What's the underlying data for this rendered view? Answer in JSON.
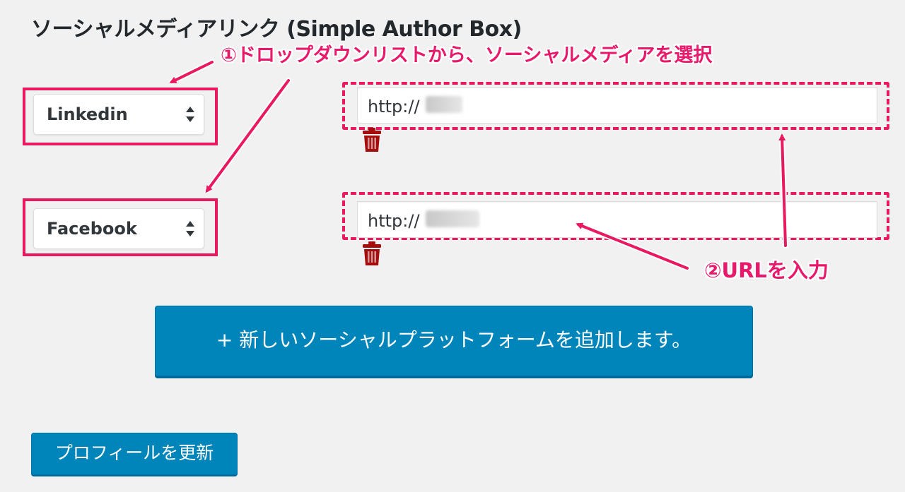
{
  "section": {
    "title": "ソーシャルメディアリンク (Simple Author Box)"
  },
  "annotations": {
    "step1": "①ドロップダウンリストから、ソーシャルメディアを選択",
    "step2": "②URLを入力",
    "color": "#e8195f"
  },
  "social_links": [
    {
      "platform": "Linkedin",
      "url_prefix": "http://",
      "delete_icon": "trash-icon"
    },
    {
      "platform": "Facebook",
      "url_prefix": "http://",
      "delete_icon": "trash-icon"
    }
  ],
  "buttons": {
    "add_platform": "+ 新しいソーシャルプラットフォームを追加します。",
    "update_profile": "プロフィールを更新"
  },
  "colors": {
    "primary_button": "#0085ba",
    "trash": "#a50d0d",
    "background": "#f1f1f1"
  }
}
